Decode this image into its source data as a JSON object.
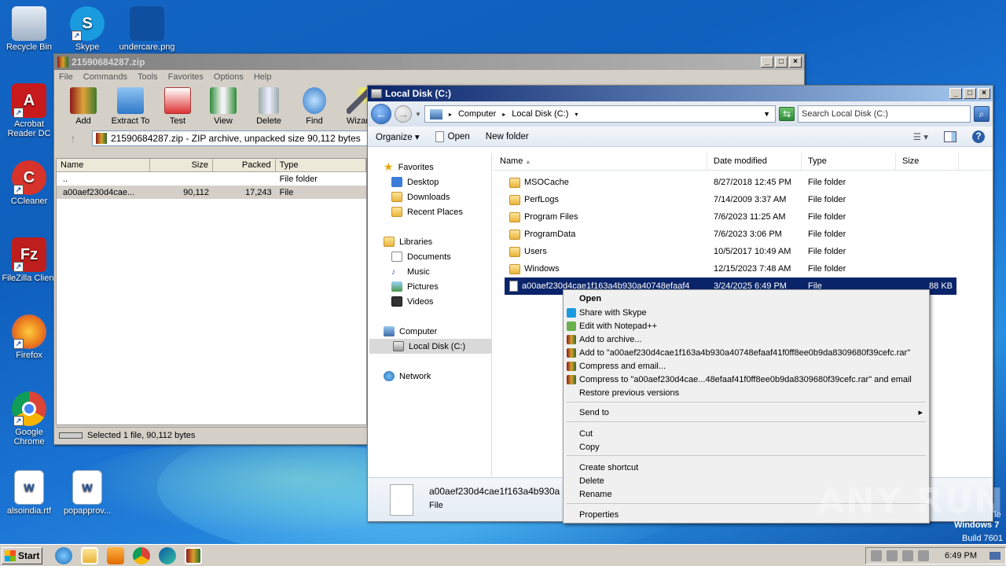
{
  "desktop": {
    "icons": [
      {
        "label": "Recycle Bin",
        "icon": "recycle-bin-icon",
        "color": "#b9c6d4"
      },
      {
        "label": "Skype",
        "icon": "skype-icon",
        "color": "#1a9be0"
      },
      {
        "label": "undercare.png",
        "icon": "image-file-icon",
        "color": "#0f4f9f"
      },
      {
        "label": "Acrobat Reader DC",
        "icon": "acrobat-icon",
        "color": "#c8191d"
      },
      {
        "label": "CCleaner",
        "icon": "ccleaner-icon",
        "color": "#d8332b"
      },
      {
        "label": "FileZilla Client",
        "icon": "filezilla-icon",
        "color": "#bf1e1e"
      },
      {
        "label": "Firefox",
        "icon": "firefox-icon",
        "color": "#e8731b"
      },
      {
        "label": "Google Chrome",
        "icon": "chrome-icon",
        "color": "#1f8e3d"
      },
      {
        "label": "alsoindia.rtf",
        "icon": "word-doc-icon",
        "color": "#2b579a"
      },
      {
        "label": "popapprov...",
        "icon": "word-doc-icon",
        "color": "#2b579a"
      }
    ],
    "watermark": "ANY RUN",
    "os_line1": "Windows 7",
    "os_line2": "Build 7601",
    "os_edge": "le"
  },
  "winrar": {
    "title": "21590684287.zip",
    "menu": [
      "File",
      "Commands",
      "Tools",
      "Favorites",
      "Options",
      "Help"
    ],
    "tools": [
      "Add",
      "Extract To",
      "Test",
      "View",
      "Delete",
      "Find",
      "Wizard"
    ],
    "path": "21590684287.zip - ZIP archive, unpacked size 90,112 bytes",
    "columns": [
      "Name",
      "Size",
      "Packed",
      "Type"
    ],
    "rows": [
      {
        "name": "..",
        "size": "",
        "packed": "",
        "type": "File folder"
      },
      {
        "name": "a00aef230d4cae...",
        "size": "90,112",
        "packed": "17,243",
        "type": "File"
      }
    ],
    "status": "Selected 1 file, 90,112 bytes"
  },
  "explorer": {
    "title": "Local Disk (C:)",
    "breadcrumb": [
      "Computer",
      "Local Disk (C:)"
    ],
    "search_placeholder": "Search Local Disk (C:)",
    "commands": [
      "Organize",
      "Open",
      "New folder"
    ],
    "nav": {
      "favorites": "Favorites",
      "fav_items": [
        "Desktop",
        "Downloads",
        "Recent Places"
      ],
      "libraries": "Libraries",
      "lib_items": [
        "Documents",
        "Music",
        "Pictures",
        "Videos"
      ],
      "computer": "Computer",
      "computer_items": [
        "Local Disk (C:)"
      ],
      "network": "Network"
    },
    "columns": [
      "Name",
      "Date modified",
      "Type",
      "Size"
    ],
    "files": [
      {
        "name": "MSOCache",
        "date": "8/27/2018 12:45 PM",
        "type": "File folder",
        "size": ""
      },
      {
        "name": "PerfLogs",
        "date": "7/14/2009 3:37 AM",
        "type": "File folder",
        "size": ""
      },
      {
        "name": "Program Files",
        "date": "7/6/2023 11:25 AM",
        "type": "File folder",
        "size": ""
      },
      {
        "name": "ProgramData",
        "date": "7/6/2023 3:06 PM",
        "type": "File folder",
        "size": ""
      },
      {
        "name": "Users",
        "date": "10/5/2017 10:49 AM",
        "type": "File folder",
        "size": ""
      },
      {
        "name": "Windows",
        "date": "12/15/2023 7:48 AM",
        "type": "File folder",
        "size": ""
      },
      {
        "name": "a00aef230d4cae1f163a4b930a40748efaaf4",
        "date": "3/24/2025 6:49 PM",
        "type": "File",
        "size": "88 KB"
      }
    ],
    "details_name": "a00aef230d4cae1f163a4b930a",
    "details_type": "File"
  },
  "context_menu": [
    {
      "label": "Open",
      "bold": true
    },
    {
      "label": "Share with Skype",
      "icon": "skype-icon"
    },
    {
      "label": "Edit with Notepad++",
      "icon": "notepad-icon"
    },
    {
      "label": "Add to archive...",
      "icon": "winrar-icon"
    },
    {
      "label": "Add to \"a00aef230d4cae1f163a4b930a40748efaaf41f0ff8ee0b9da8309680f39cefc.rar\"",
      "icon": "winrar-icon"
    },
    {
      "label": "Compress and email...",
      "icon": "winrar-icon"
    },
    {
      "label": "Compress to \"a00aef230d4cae...48efaaf41f0ff8ee0b9da8309680f39cefc.rar\" and email",
      "icon": "winrar-icon"
    },
    {
      "label": "Restore previous versions"
    },
    {
      "label": "Send to",
      "submenu": true
    },
    {
      "label": "Cut"
    },
    {
      "label": "Copy"
    },
    {
      "label": "Create shortcut"
    },
    {
      "label": "Delete"
    },
    {
      "label": "Rename"
    },
    {
      "label": "Properties"
    }
  ],
  "taskbar": {
    "start": "Start",
    "clock": "6:49 PM"
  }
}
